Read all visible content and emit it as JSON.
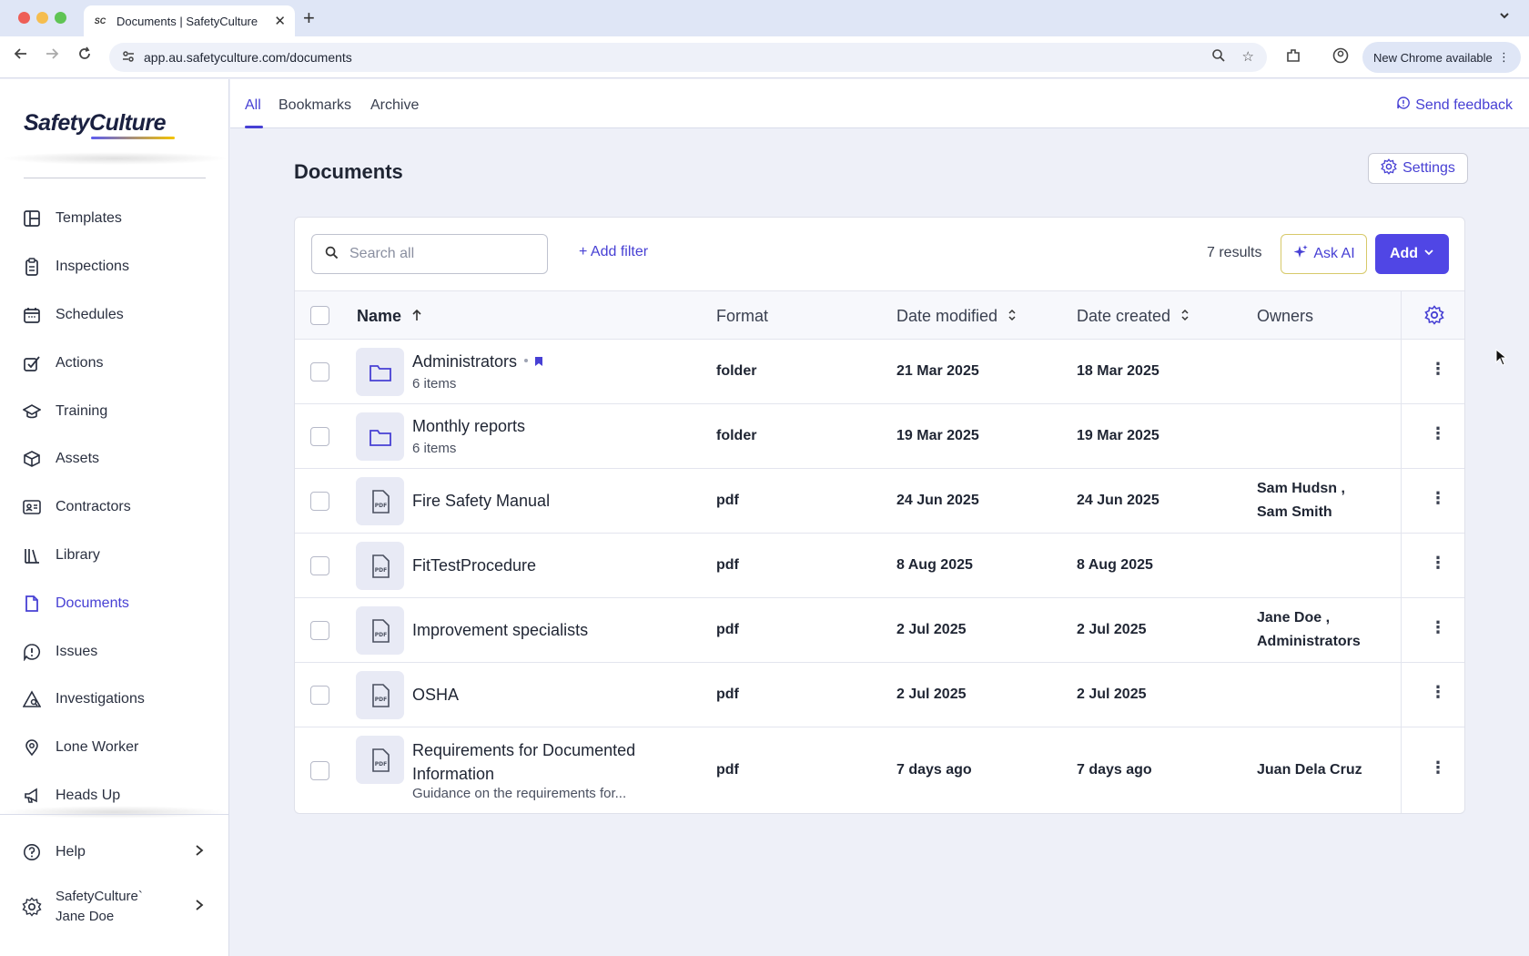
{
  "browser": {
    "tab_title": "Documents | SafetyCulture",
    "tab_favicon": "SC",
    "url": "app.au.safetyculture.com/documents",
    "chrome_update": "New Chrome available"
  },
  "sidebar": {
    "logo": "SafetyCulture",
    "items": [
      {
        "label": "Templates",
        "icon": "template-icon"
      },
      {
        "label": "Inspections",
        "icon": "inspection-icon"
      },
      {
        "label": "Schedules",
        "icon": "calendar-icon"
      },
      {
        "label": "Actions",
        "icon": "actions-icon"
      },
      {
        "label": "Training",
        "icon": "graduation-cap-icon"
      },
      {
        "label": "Assets",
        "icon": "cube-icon"
      },
      {
        "label": "Contractors",
        "icon": "id-card-icon"
      },
      {
        "label": "Library",
        "icon": "library-icon"
      },
      {
        "label": "Documents",
        "icon": "document-icon",
        "active": true
      },
      {
        "label": "Issues",
        "icon": "alert-icon"
      },
      {
        "label": "Investigations",
        "icon": "investigation-icon"
      },
      {
        "label": "Lone Worker",
        "icon": "map-pin-icon"
      },
      {
        "label": "Heads Up",
        "icon": "megaphone-icon"
      }
    ],
    "help": "Help",
    "org_name": "SafetyCulture`",
    "user_name": "Jane Doe"
  },
  "topnav": {
    "tabs": [
      "All",
      "Bookmarks",
      "Archive"
    ],
    "active_tab": "All",
    "feedback": "Send feedback"
  },
  "page": {
    "title": "Documents",
    "settings": "Settings"
  },
  "toolbar": {
    "search_placeholder": "Search all",
    "add_filter": "Add filter",
    "results": "7 results",
    "ask_ai": "Ask AI",
    "add": "Add"
  },
  "table": {
    "headers": {
      "name": "Name",
      "format": "Format",
      "date_modified": "Date modified",
      "date_created": "Date created",
      "owners": "Owners"
    },
    "rows": [
      {
        "name": "Administrators",
        "sub": "6 items",
        "format": "folder",
        "modified": "21 Mar 2025",
        "created": "18 Mar 2025",
        "owners": [
          "",
          ""
        ],
        "type": "folder",
        "bookmarked": true
      },
      {
        "name": "Monthly reports",
        "sub": "6 items",
        "format": "folder",
        "modified": "19 Mar 2025",
        "created": "19 Mar 2025",
        "owners": [
          "",
          ""
        ],
        "type": "folder"
      },
      {
        "name": "Fire Safety Manual",
        "sub": "",
        "format": "pdf",
        "modified": "24 Jun 2025",
        "created": "24 Jun 2025",
        "owners": [
          "Sam Hudsn ,",
          "Sam Smith"
        ],
        "type": "pdf"
      },
      {
        "name": "FitTestProcedure",
        "sub": "",
        "format": "pdf",
        "modified": "8 Aug 2025",
        "created": "8 Aug 2025",
        "owners": [
          "",
          ""
        ],
        "type": "pdf"
      },
      {
        "name": "Improvement specialists",
        "sub": "",
        "format": "pdf",
        "modified": "2 Jul 2025",
        "created": "2 Jul 2025",
        "owners": [
          "Jane Doe ,",
          "Administrators"
        ],
        "type": "pdf"
      },
      {
        "name": "OSHA",
        "sub": "",
        "format": "pdf",
        "modified": "2 Jul 2025",
        "created": "2 Jul 2025",
        "owners": [
          "",
          ""
        ],
        "type": "pdf"
      },
      {
        "name_line1": "Requirements for Documented",
        "name_line2": "Information",
        "sub": "Guidance on the requirements for...",
        "format": "pdf",
        "modified": "7 days ago",
        "created": "7 days ago",
        "owners": [
          "Juan Dela Cruz",
          ""
        ],
        "type": "pdf"
      }
    ]
  },
  "colors": {
    "accent": "#4740d4",
    "add_button": "#5046e5",
    "background": "#eef0f8"
  }
}
